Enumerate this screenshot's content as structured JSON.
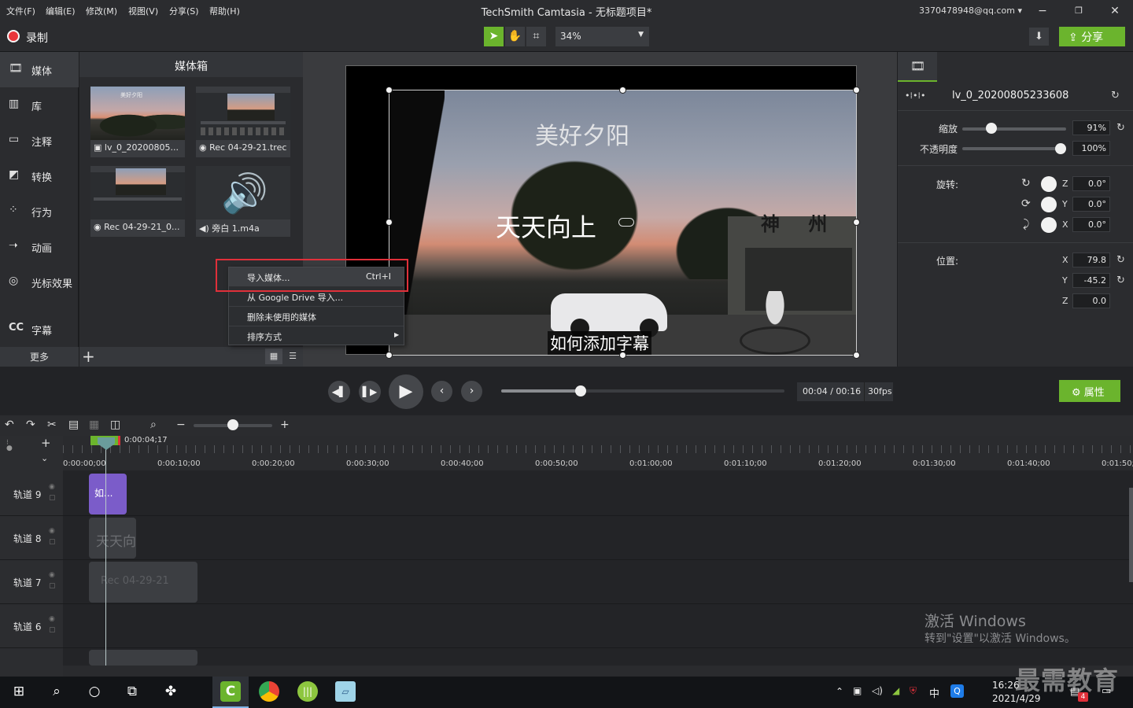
{
  "menu": {
    "items": [
      "文件(F)",
      "编辑(E)",
      "修改(M)",
      "视图(V)",
      "分享(S)",
      "帮助(H)"
    ],
    "title": "TechSmith Camtasia - 无标题项目*",
    "account": "3370478948@qq.com"
  },
  "toolbar": {
    "record_label": "录制",
    "zoom": "34%",
    "share_label": "分享"
  },
  "sidebar": {
    "items": [
      {
        "label": "媒体",
        "icon": "film-icon"
      },
      {
        "label": "库",
        "icon": "library-icon"
      },
      {
        "label": "注释",
        "icon": "annotation-icon"
      },
      {
        "label": "转换",
        "icon": "transition-icon"
      },
      {
        "label": "行为",
        "icon": "behavior-icon"
      },
      {
        "label": "动画",
        "icon": "animation-icon"
      },
      {
        "label": "光标效果",
        "icon": "cursor-icon"
      },
      {
        "label": "字幕",
        "icon": "cc-icon"
      }
    ],
    "more_label": "更多"
  },
  "bin": {
    "title": "媒体箱",
    "tiles": [
      {
        "label": "lv_0_20200805...",
        "caption": "美好夕阳"
      },
      {
        "label": "Rec 04-29-21.trec"
      },
      {
        "label": "Rec 04-29-21_0..."
      },
      {
        "label": "旁白 1.m4a"
      }
    ]
  },
  "context_menu": {
    "items": [
      {
        "label": "导入媒体...",
        "shortcut": "Ctrl+I"
      },
      {
        "label": "从 Google Drive 导入..."
      },
      {
        "label": "删除未使用的媒体"
      },
      {
        "label": "排序方式"
      }
    ]
  },
  "canvas": {
    "caption_top": "美好夕阳",
    "caption_mid": "天天向上",
    "caption_bottom": "如何添加字幕",
    "sign_text": "神 州"
  },
  "properties": {
    "clip_name": "lv_0_20200805233608",
    "scale_label": "缩放",
    "scale_value": "91%",
    "scale_fraction": 0.25,
    "opacity_label": "不透明度",
    "opacity_value": "100%",
    "opacity_fraction": 1.0,
    "rotation_label": "旋转:",
    "rotation": [
      {
        "axis": "Z",
        "value": "0.0°"
      },
      {
        "axis": "Y",
        "value": "0.0°"
      },
      {
        "axis": "X",
        "value": "0.0°"
      }
    ],
    "position_label": "位置:",
    "position": [
      {
        "axis": "X",
        "value": "79.8"
      },
      {
        "axis": "Y",
        "value": "-45.2"
      },
      {
        "axis": "Z",
        "value": "0.0"
      }
    ]
  },
  "playback": {
    "time": "00:04 / 00:16",
    "fps": "30fps",
    "progress": 0.28,
    "properties_label": "属性"
  },
  "timeline": {
    "playhead_time": "0:00:04;17",
    "ticks": [
      "0:00:00;00",
      "0:00:10;00",
      "0:00:20;00",
      "0:00:30;00",
      "0:00:40;00",
      "0:00:50;00",
      "0:01:00;00",
      "0:01:10;00",
      "0:01:20;00",
      "0:01:30;00",
      "0:01:40;00",
      "0:01:50;"
    ],
    "tracks": [
      "轨道 9",
      "轨道 8",
      "轨道 7",
      "轨道 6"
    ],
    "clips": {
      "track9": "如...",
      "track8": "天天向",
      "track7": "Rec 04-29-21"
    }
  },
  "watermark": {
    "line1": "激活 Windows",
    "line2": "转到\"设置\"以激活 Windows。",
    "brand": "最需教育"
  },
  "taskbar": {
    "time": "16:26",
    "date": "2021/4/29",
    "ime": "中",
    "badge": "4"
  },
  "colors": {
    "accent": "#6bb42d",
    "record": "#e9363b",
    "highlight": "#e0303a",
    "annotation_clip": "#7b5cc9"
  }
}
